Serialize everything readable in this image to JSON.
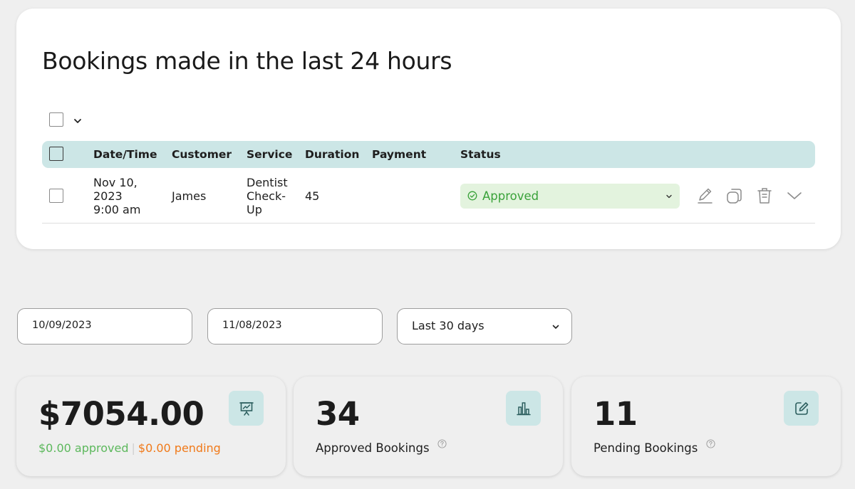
{
  "bookings": {
    "title": "Bookings made in the last 24 hours",
    "columns": [
      "Date/Time",
      "Customer",
      "Service",
      "Duration",
      "Payment",
      "Status"
    ],
    "rows": [
      {
        "date_time": "Nov 10,\n2023\n9:00 am",
        "customer": "James",
        "service": "Dentist\nCheck-\nUp",
        "duration": "45",
        "payment": "",
        "status": "Approved"
      }
    ],
    "row_actions": [
      "edit-icon",
      "duplicate-icon",
      "trash-icon",
      "chevron-down-icon"
    ]
  },
  "filters": {
    "date_from": "10/09/2023",
    "date_to": "11/08/2023",
    "range": "Last 30 days"
  },
  "stats": {
    "revenue": {
      "value": "$7054.00",
      "approved": "$0.00 approved",
      "separator": "|",
      "pending": "$0.00 pending",
      "icon": "presentation-chart-icon"
    },
    "approved_bookings": {
      "value": "34",
      "label": "Approved Bookings",
      "icon": "bar-chart-icon"
    },
    "pending_bookings": {
      "value": "11",
      "label": "Pending Bookings",
      "icon": "edit-square-icon"
    }
  },
  "colors": {
    "accent_teal": "#cce6e6",
    "approved_green": "#3aa23a",
    "approved_bg": "#e3f3de",
    "pending_orange": "#f07a1a",
    "page_bg": "#efefef"
  }
}
